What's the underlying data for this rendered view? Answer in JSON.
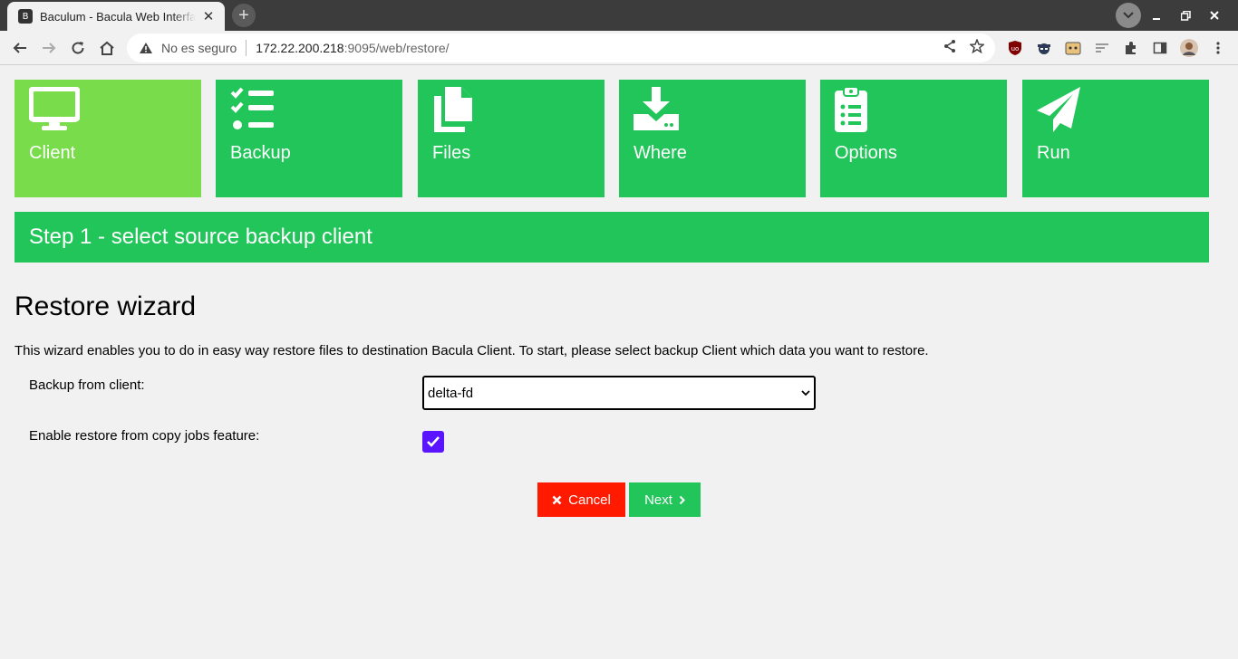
{
  "browser": {
    "tab_title": "Baculum - Bacula Web Interface",
    "favicon_text": "B",
    "new_tab_symbol": "+",
    "address": {
      "security_label": "No es seguro",
      "host": "172.22.200.218",
      "path": ":9095/web/restore/"
    }
  },
  "steps": [
    {
      "label": "Client",
      "icon": "desktop-icon",
      "active": true
    },
    {
      "label": "Backup",
      "icon": "checklist-icon",
      "active": false
    },
    {
      "label": "Files",
      "icon": "files-icon",
      "active": false
    },
    {
      "label": "Where",
      "icon": "download-drive-icon",
      "active": false
    },
    {
      "label": "Options",
      "icon": "clipboard-list-icon",
      "active": false
    },
    {
      "label": "Run",
      "icon": "paper-plane-icon",
      "active": false
    }
  ],
  "banner": "Step 1 - select source backup client",
  "page_title": "Restore wizard",
  "intro": "This wizard enables you to do in easy way restore files to destination Bacula Client. To start, please select backup Client which data you want to restore.",
  "form": {
    "client_label": "Backup from client:",
    "client_value": "delta-fd",
    "copy_jobs_label": "Enable restore from copy jobs feature:",
    "copy_jobs_checked": true
  },
  "buttons": {
    "cancel": "Cancel",
    "next": "Next"
  },
  "colors": {
    "step_green": "#22c55a",
    "step_active": "#79dc4a",
    "cancel_red": "#ff1a00",
    "checkbox": "#5a14ff"
  }
}
